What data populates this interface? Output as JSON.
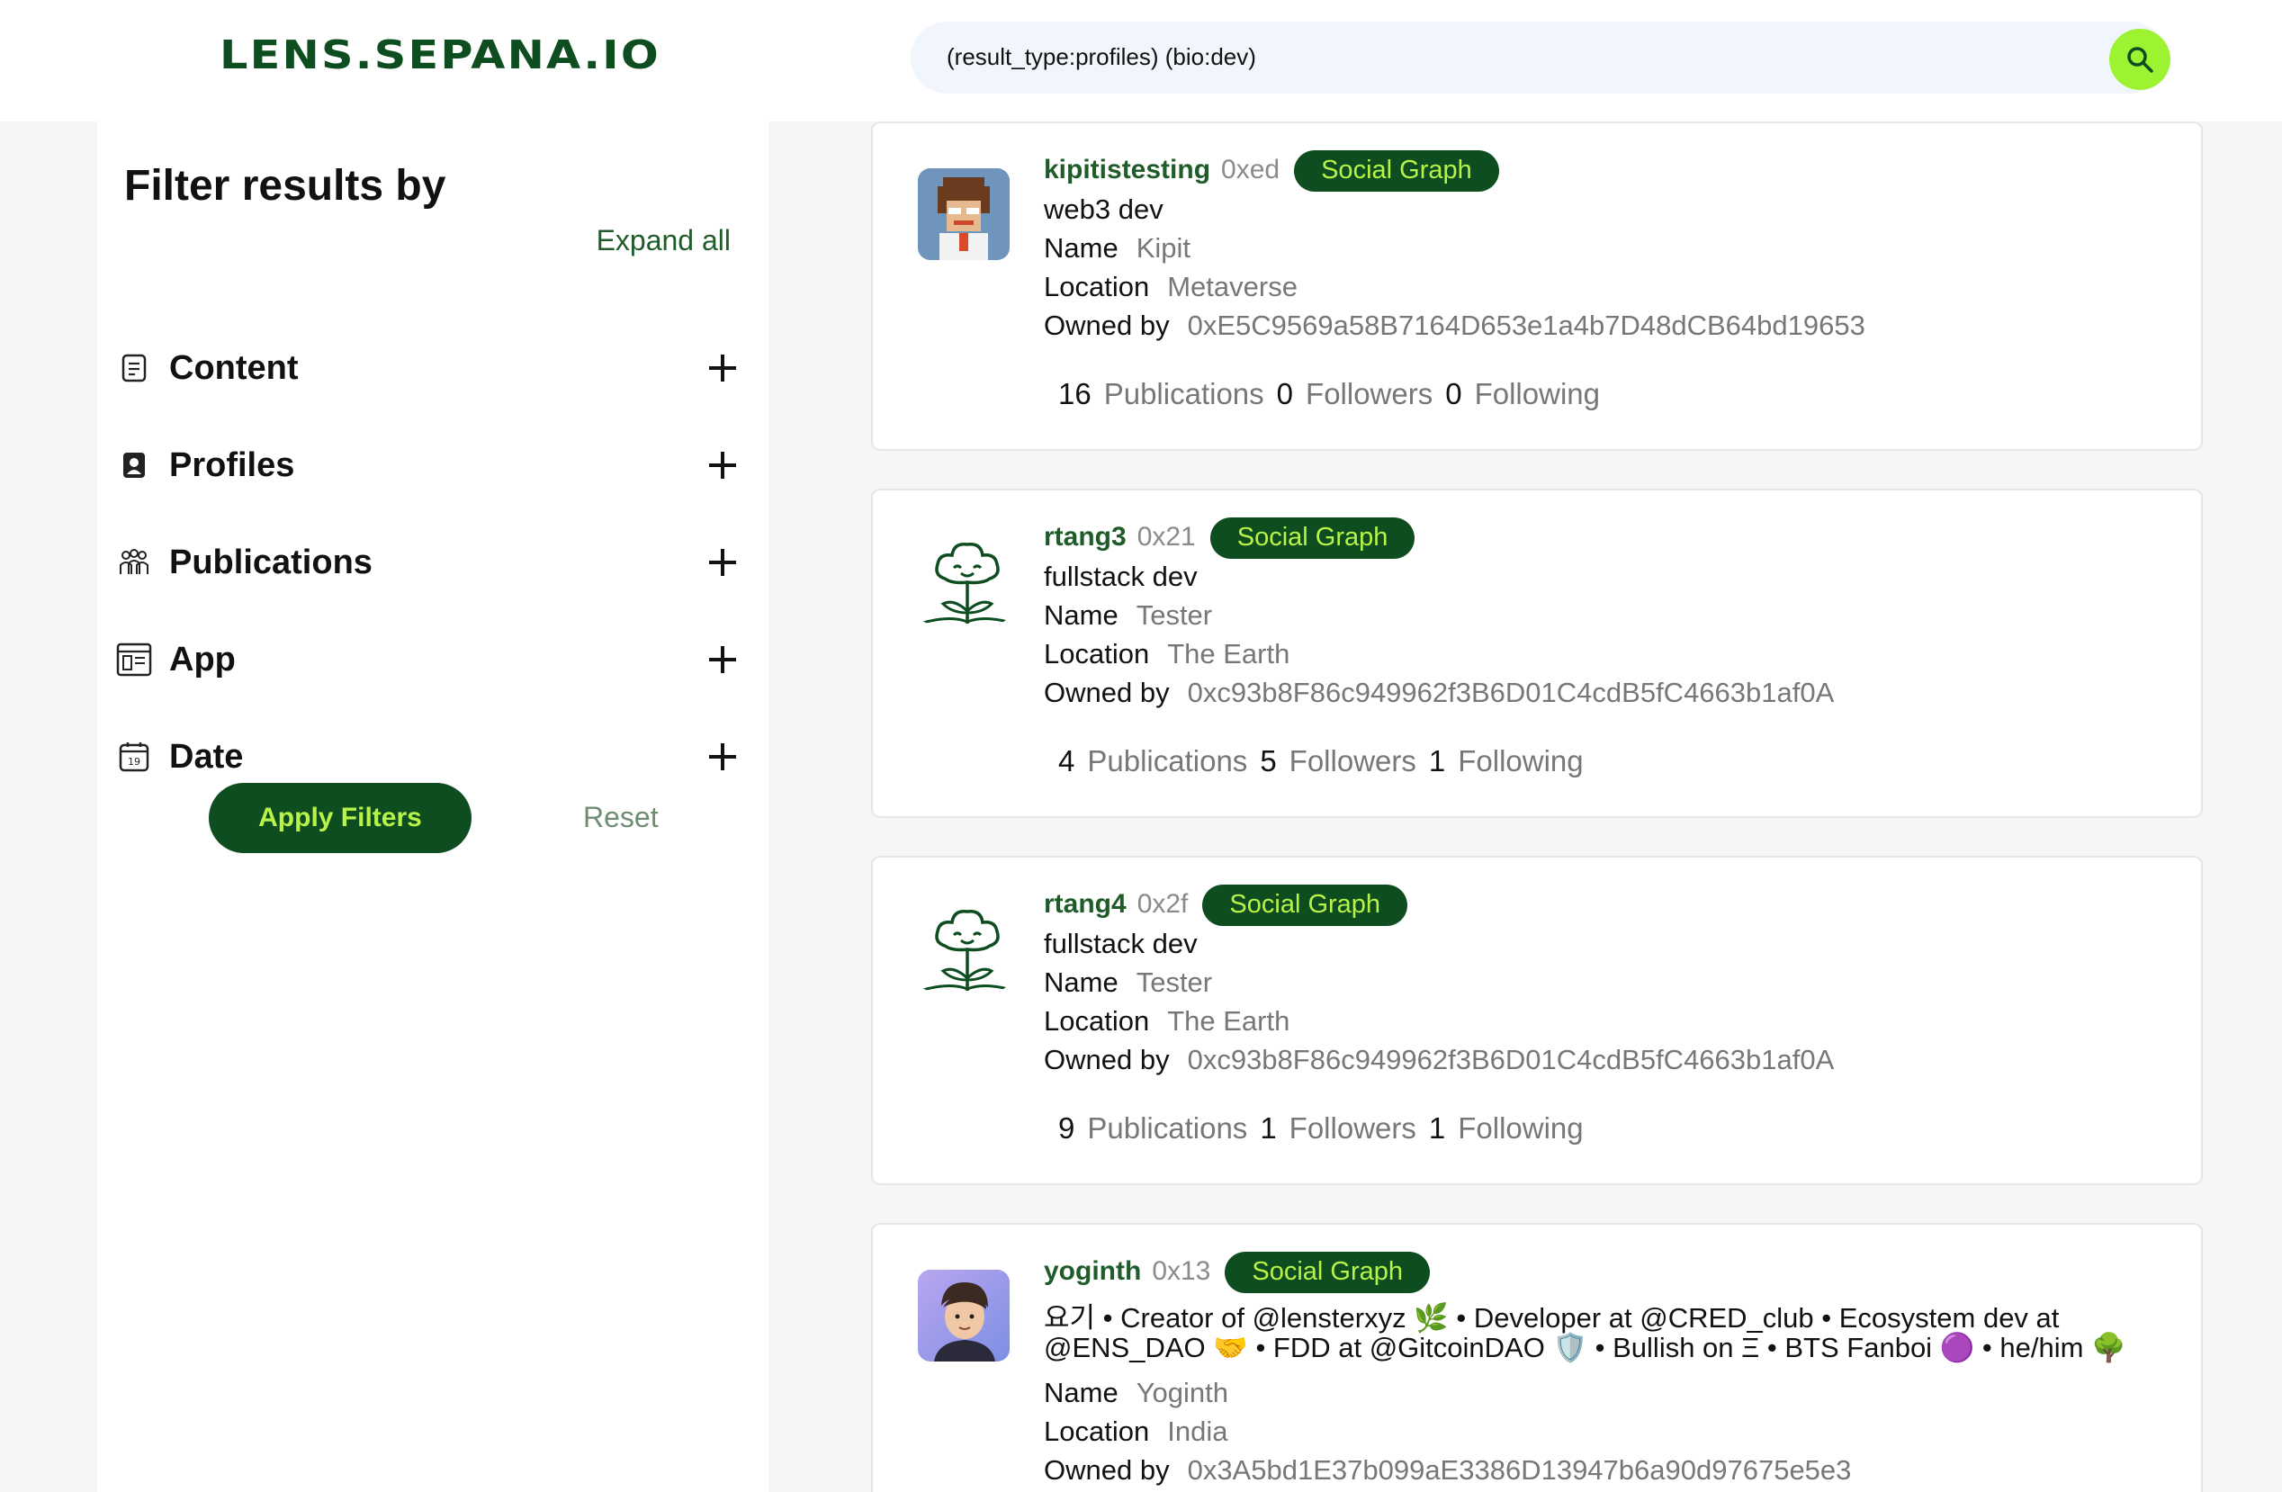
{
  "header": {
    "logo": "LENS.SEPANA.IO",
    "search_value": "(result_type:profiles) (bio:dev)"
  },
  "sidebar": {
    "title": "Filter results by",
    "expand_all": "Expand all",
    "filters": [
      {
        "label": "Content",
        "icon": "document-icon"
      },
      {
        "label": "Profiles",
        "icon": "profile-icon"
      },
      {
        "label": "Publications",
        "icon": "people-icon"
      },
      {
        "label": "App",
        "icon": "app-icon"
      },
      {
        "label": "Date",
        "icon": "calendar-icon"
      }
    ],
    "calendar_day": "19",
    "apply_label": "Apply Filters",
    "reset_label": "Reset"
  },
  "labels": {
    "name": "Name",
    "location": "Location",
    "owned_by": "Owned by",
    "publications": "Publications",
    "followers": "Followers",
    "following": "Following"
  },
  "results": [
    {
      "handle": "kipitistesting",
      "id": "0xed",
      "badge": "Social Graph",
      "bio": "web3 dev",
      "name": "Kipit",
      "location": "Metaverse",
      "owner": "0xE5C9569a58B7164D653e1a4b7D48dCB64bd19653",
      "publications": "16",
      "followers": "0",
      "following": "0"
    },
    {
      "handle": "rtang3",
      "id": "0x21",
      "badge": "Social Graph",
      "bio": "fullstack dev",
      "name": "Tester",
      "location": "The Earth",
      "owner": "0xc93b8F86c949962f3B6D01C4cdB5fC4663b1af0A",
      "publications": "4",
      "followers": "5",
      "following": "1"
    },
    {
      "handle": "rtang4",
      "id": "0x2f",
      "badge": "Social Graph",
      "bio": "fullstack dev",
      "name": "Tester",
      "location": "The Earth",
      "owner": "0xc93b8F86c949962f3B6D01C4cdB5fC4663b1af0A",
      "publications": "9",
      "followers": "1",
      "following": "1"
    },
    {
      "handle": "yoginth",
      "id": "0x13",
      "badge": "Social Graph",
      "bio_line1": "요기 • Creator of @lensterxyz 🌿 • Developer at @CRED_club • Ecosystem dev at",
      "bio_line2": "@ENS_DAO 🤝 • FDD at @GitcoinDAO 🛡️ • Bullish on Ξ • BTS Fanboi 🟣 • he/him 🌳",
      "name": "Yoginth",
      "location": "India",
      "owner": "0x3A5bd1E37b099aE3386D13947b6a90d97675e5e3"
    }
  ]
}
